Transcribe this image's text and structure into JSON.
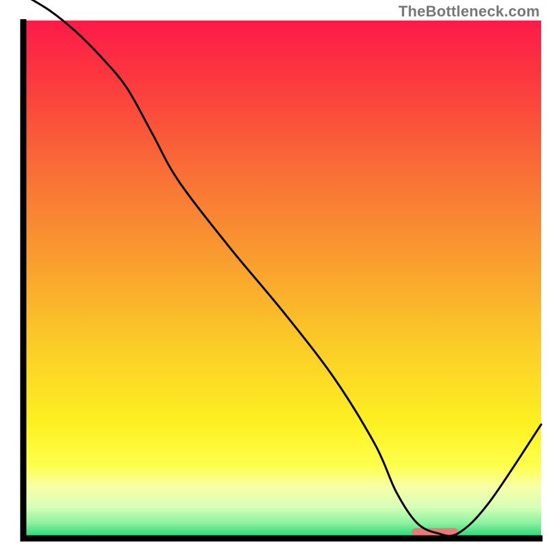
{
  "watermark": "TheBottleneck.com",
  "chart_data": {
    "type": "line",
    "title": "",
    "xlabel": "",
    "ylabel": "",
    "xlim": [
      0,
      100
    ],
    "ylim": [
      0,
      100
    ],
    "series": [
      {
        "name": "curve",
        "x": [
          0,
          5,
          10,
          15,
          20,
          25,
          30,
          40,
          50,
          60,
          68,
          72,
          76,
          80,
          84,
          90,
          100
        ],
        "y": [
          105,
          102,
          98,
          93,
          87,
          78,
          69,
          56,
          44,
          31,
          18,
          9,
          3,
          1,
          1,
          7,
          22
        ]
      }
    ],
    "highlight_bar": {
      "x_start": 75,
      "x_end": 84,
      "y": 1.2,
      "color": "#ea7a75"
    },
    "gradient_stops": [
      {
        "offset": 0.0,
        "color": "#fd1a49"
      },
      {
        "offset": 0.12,
        "color": "#fc3b3e"
      },
      {
        "offset": 0.28,
        "color": "#f96b37"
      },
      {
        "offset": 0.45,
        "color": "#f99a2f"
      },
      {
        "offset": 0.62,
        "color": "#fbca28"
      },
      {
        "offset": 0.78,
        "color": "#fdf122"
      },
      {
        "offset": 0.86,
        "color": "#feff4d"
      },
      {
        "offset": 0.9,
        "color": "#f8ffa6"
      },
      {
        "offset": 0.94,
        "color": "#d6ffb8"
      },
      {
        "offset": 0.97,
        "color": "#8cf2a0"
      },
      {
        "offset": 1.0,
        "color": "#19d46d"
      }
    ],
    "axis_color": "#000000",
    "curve_color": "#000000"
  }
}
